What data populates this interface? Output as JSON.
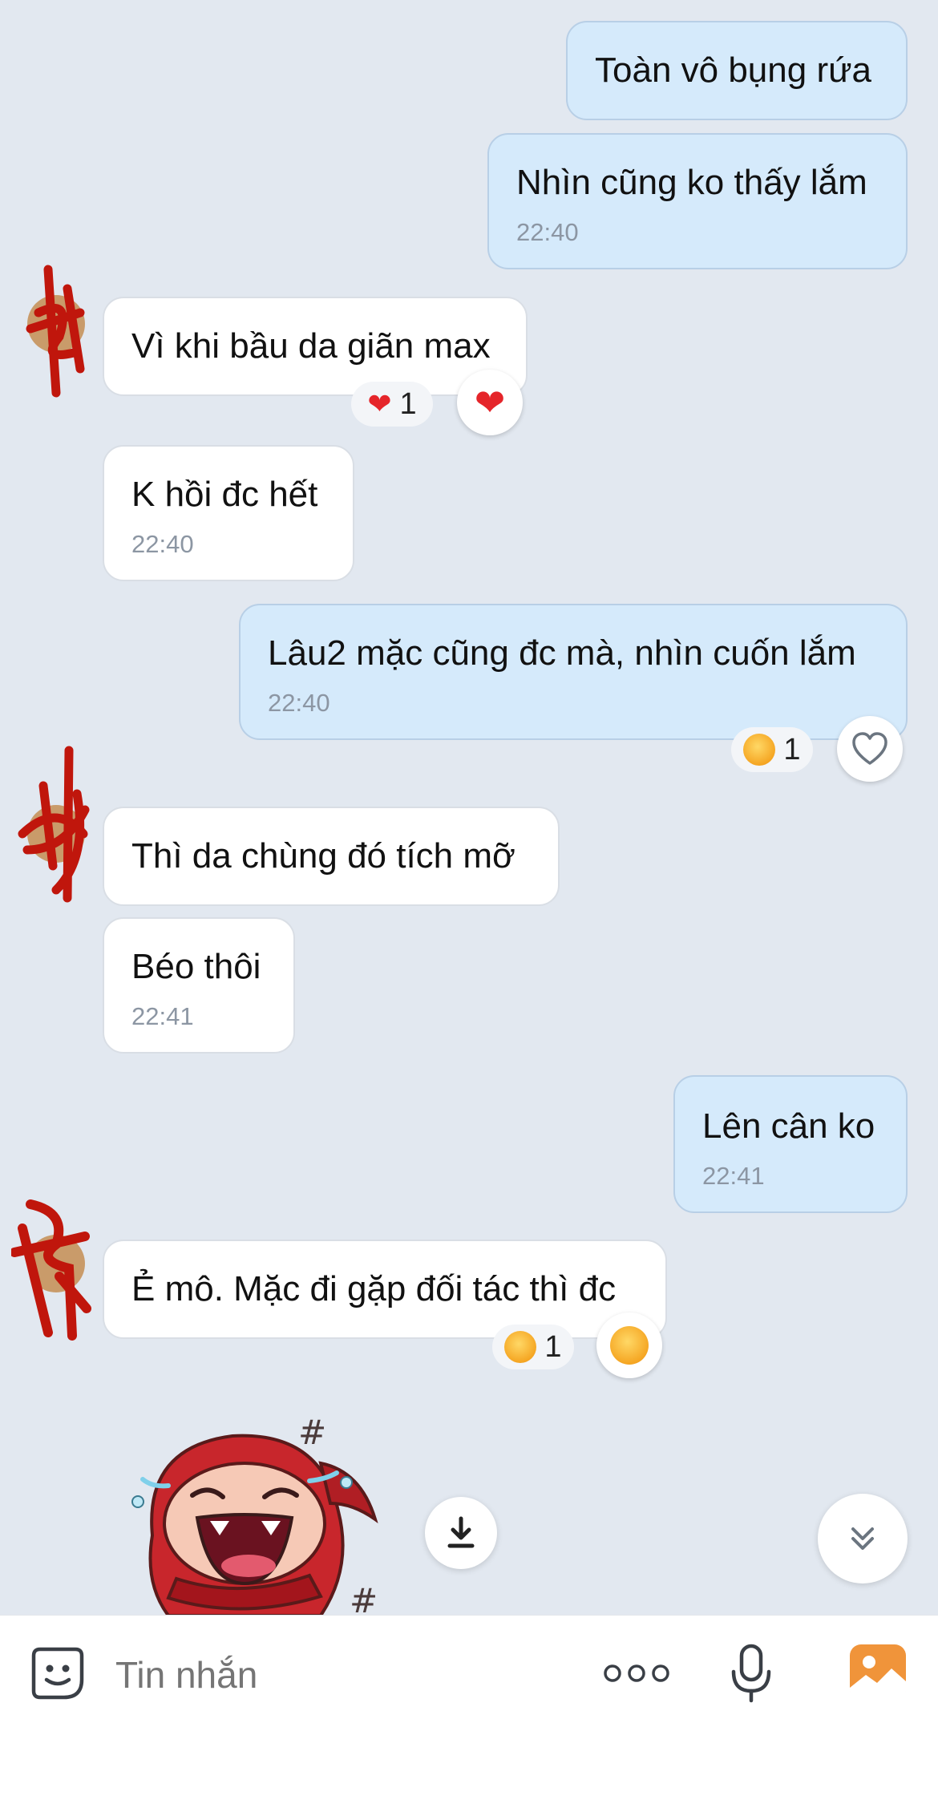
{
  "messages": [
    {
      "text": "Toàn vô bụng rứa",
      "time": ""
    },
    {
      "text": "Nhìn cũng ko thấy lắm",
      "time": "22:40"
    },
    {
      "text": "Vì khi bầu da giãn max",
      "time": "",
      "reaction": {
        "emoji": "❤️",
        "count": "1"
      }
    },
    {
      "text": "K hồi đc hết",
      "time": "22:40"
    },
    {
      "text": "Lâu2 mặc cũng đc mà, nhìn cuốn lắm",
      "time": "22:40",
      "reaction": {
        "emoji": "laughing-face",
        "count": "1"
      }
    },
    {
      "text": "Thì da chùng đó tích mỡ",
      "time": ""
    },
    {
      "text": "Béo thôi",
      "time": "22:41"
    },
    {
      "text": "Lên cân ko",
      "time": "22:41"
    },
    {
      "text": "Ẻ mô. Mặc đi gặp đối tác thì đc",
      "time": "",
      "reaction": {
        "emoji": "laughing-face",
        "count": "1"
      }
    }
  ],
  "sticker": {
    "subject": "laughing red-hooded character",
    "marks": [
      "#",
      "#"
    ]
  },
  "composer": {
    "placeholder": "Tin nhắn"
  },
  "colors": {
    "outgoing_bubble": "#d5eafb",
    "incoming_bubble": "#ffffff",
    "background": "#e2e8f0",
    "photo_button": "#f0943a",
    "redaction": "#c0160c"
  },
  "icons": [
    "sticker-icon",
    "more-icon",
    "microphone-icon",
    "image-icon",
    "download-icon",
    "scroll-down-icon",
    "heart-outline-icon"
  ]
}
